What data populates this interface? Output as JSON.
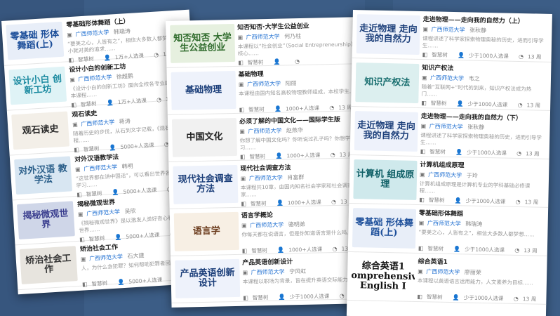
{
  "common": {
    "university": "广西师范大学",
    "platform": "智慧树",
    "weeks_13": "13 周"
  },
  "left": [
    {
      "title": "零基础形体舞蹈（上）",
      "teacher": "韩瑞涛",
      "desc": "“要美之心，人皆有之”，相信大多数人都梦想，从小就对美的追求……",
      "count": "1万+人选课",
      "weeks": "13 周",
      "thumb": "零基础 形体舞蹈(上)",
      "bg": "#e8eef8",
      "fg": "#1d4f9a"
    },
    {
      "title": "设计小白的创新工坊",
      "teacher": "徐超鹏",
      "desc": "《设计小白的创新工坊》面向全校各专业的学生，本课程……",
      "count": "1万+人选课",
      "weeks": "13 周",
      "thumb": "设计小白 创新工坊",
      "bg": "#dff3f6",
      "fg": "#1a8aa0"
    },
    {
      "title": "观石读史",
      "teacher": "蒋涛",
      "desc": "随着历史的步伐，从石到文字记载，《观石读史》课程……",
      "count": "5000+人选课",
      "weeks": "13 周",
      "thumb": "观石读史",
      "bg": "#f3efe8",
      "fg": "#2a2a2a"
    },
    {
      "title": "对外汉语教学法",
      "teacher": "韩明",
      "desc": "“这世界都在讲中国话”，可以看出世界各地对汉语学习……",
      "count": "5000+人选课",
      "weeks": "13 周",
      "thumb": "对外汉语 教学法",
      "bg": "#d8e6f2",
      "fg": "#2b5f8a"
    },
    {
      "title": "揭秘微观世界",
      "teacher": "吴欣",
      "desc": "《揭秘微观世界》是以激发人类好奇心和探索微观世界……",
      "count": "5000+人选课",
      "weeks": "13 周",
      "thumb": "揭秘微观世界",
      "bg": "#cfd6e8",
      "fg": "#3b3f8f"
    },
    {
      "title": "矫治社会工作",
      "teacher": "石大建",
      "desc": "人，为什么会犯罪？如何帮助犯罪者回归社会……",
      "count": "5000+人选课",
      "weeks": "13 周",
      "thumb": "矫治社会工作",
      "bg": "#e7e4de",
      "fg": "#333333"
    }
  ],
  "middle": [
    {
      "tag": "",
      "title": "知否知否·大学生公益创业",
      "teacher": "何乃柱",
      "desc": "本课程以“社会创业”（Social Entrepreneurship）为核心……",
      "count": "",
      "weeks": "",
      "thumb": "知否知否 大学生公益创业",
      "bg": "#e6f0df",
      "fg": "#2f6b2c"
    },
    {
      "tag": "",
      "title": "基础物理",
      "teacher": "阳丽",
      "desc": "本课程由国内知名高校物理教师组成，本校学生……",
      "count": "1000+人选课",
      "weeks": "13 周",
      "thumb": "基础物理",
      "bg": "#eef2fb",
      "fg": "#1c3f7a"
    },
    {
      "tag": "",
      "title": "必须了解的中国文化——国际学生版",
      "teacher": "赵燕华",
      "desc": "你想了解中国文化吗？你听说过孔子吗？你想学习……",
      "count": "1000+人选课",
      "weeks": "13 周",
      "thumb": "中国文化",
      "bg": "#f1f1f1",
      "fg": "#222222"
    },
    {
      "tag": "",
      "title": "现代社会调查方法",
      "teacher": "肖富群",
      "desc": "本课程共10章，由国内知名社会学家和社会调查专家……",
      "count": "1000+人选课",
      "weeks": "13 周",
      "thumb": "现代社会调查方法",
      "bg": "#eef2fb",
      "fg": "#1c3f7a"
    },
    {
      "tag": "",
      "title": "语言学概论",
      "teacher": "骆明弟",
      "desc": "你每天都在说语言，但是你知道语言是什么吗……",
      "count": "1000+人选课",
      "weeks": "13 周",
      "thumb": "语言学",
      "bg": "#f7efe4",
      "fg": "#6b3b1c"
    },
    {
      "tag": "",
      "title": "产品英语创新设计",
      "teacher": "宁风虹",
      "desc": "本课程以职场为背景，旨在提升英语交际能力……",
      "count": "少于1000人选课",
      "weeks": "13 周",
      "thumb": "产品英语创新设计",
      "bg": "#eef2fb",
      "fg": "#1c3f7a"
    }
  ],
  "right": [
    {
      "title": "走进物理——走向我的自然力（上）",
      "teacher": "张秋静",
      "desc": "课程讲述了科学家探索物理奥秘的历史，进而引导学生……",
      "count": "少于1000人选课",
      "weeks": "13 周",
      "thumb": "走近物理 走向我的自然力",
      "bg": "#eef2fb",
      "fg": "#1c3f7a"
    },
    {
      "title": "知识产权法",
      "teacher": "韦之",
      "desc": "随着“互联网+”时代的到来，知识产权法成为热门……",
      "count": "少于1000人选课",
      "weeks": "13 周",
      "thumb": "知识产权法",
      "bg": "#dcefef",
      "fg": "#1a6f70"
    },
    {
      "title": "走进物理——走向我的自然力（下）",
      "teacher": "张秋静",
      "desc": "课程讲述了科学家探索物理奥秘的历史，进而引导学生……",
      "count": "少于1000人选课",
      "weeks": "13 周",
      "thumb": "走近物理 走向我的自然力",
      "bg": "#eef2fb",
      "fg": "#1c3f7a"
    },
    {
      "title": "计算机组成原理",
      "teacher": "于玲",
      "desc": "计算机组成原理是计算机专业的学科基础必修课程……",
      "count": "少于1000人选课",
      "weeks": "13 周",
      "thumb": "计算机 组成原理",
      "bg": "#cfe9ec",
      "fg": "#0f5f66"
    },
    {
      "title": "零基础形体舞蹈",
      "teacher": "韩瑞涛",
      "desc": "“要美之心，人皆有之”，相信大多数人都梦想……",
      "count": "少于1000人选课",
      "weeks": "13 周",
      "thumb": "零基础 形体舞蹈(上)",
      "bg": "#e8eef8",
      "fg": "#1d4f9a"
    },
    {
      "title": "综合英语1",
      "teacher": "廖丽荣",
      "desc": "本课程以英语语言运用能力，人文素养为目标……",
      "count": "少于1000人选课",
      "weeks": "13 周",
      "thumb": "综合英语1 Comprehensive English I",
      "bg": "#ffffff",
      "fg": "#111111"
    }
  ]
}
